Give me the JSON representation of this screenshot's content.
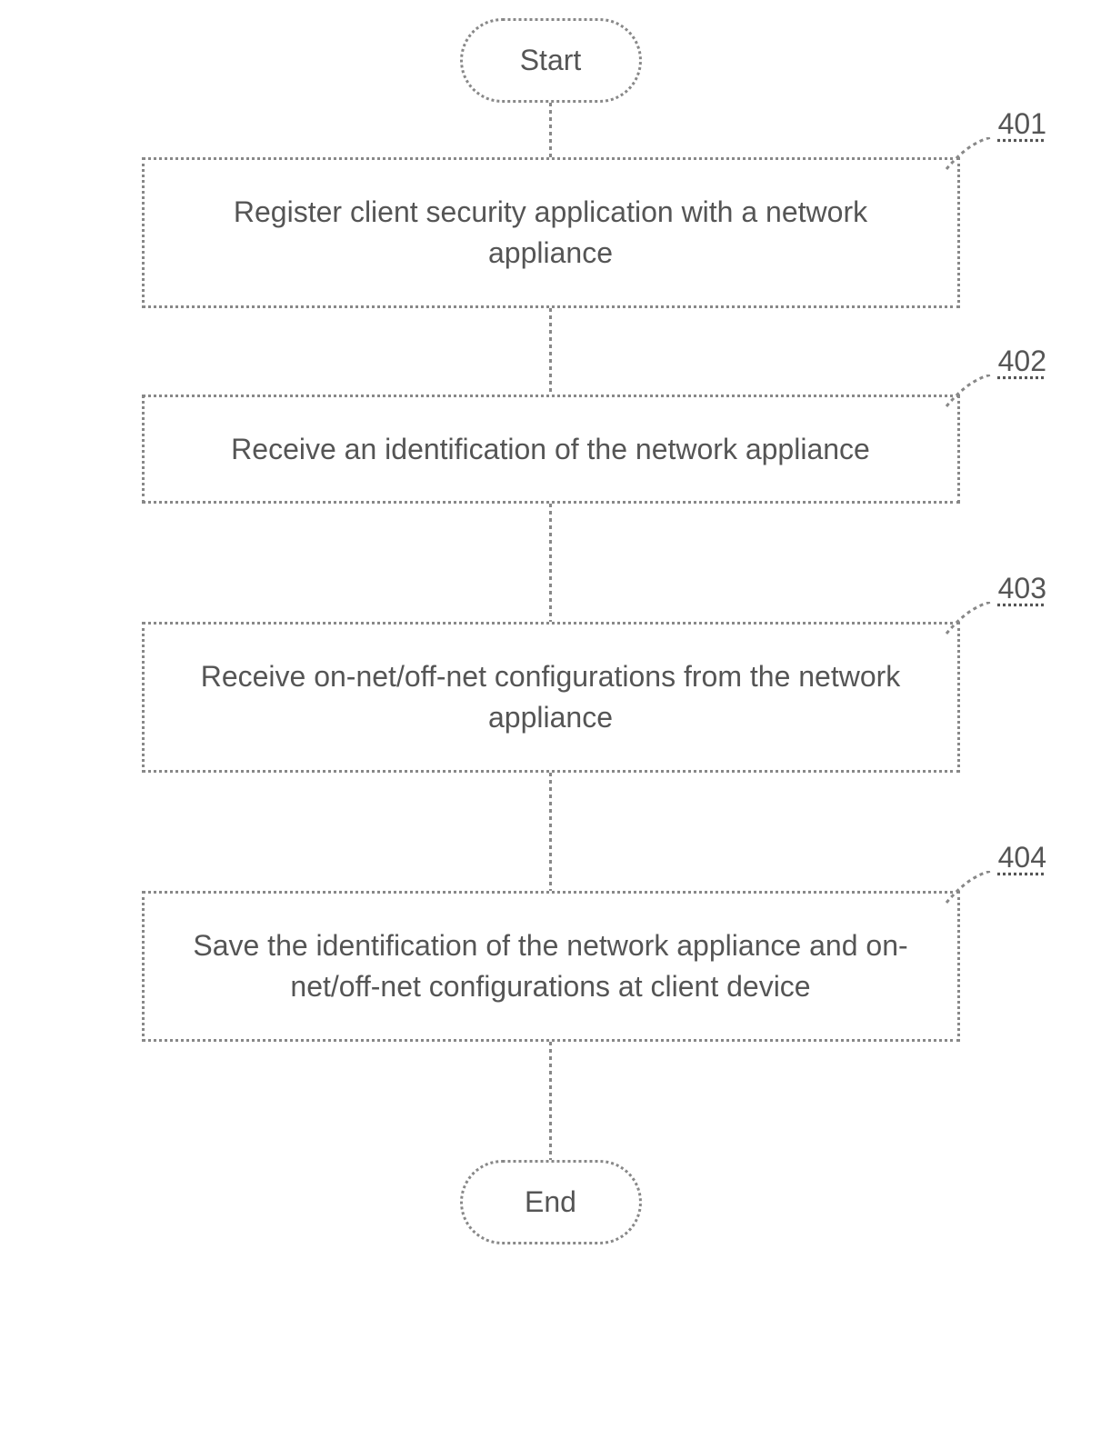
{
  "flowchart": {
    "start": "Start",
    "end": "End",
    "steps": [
      {
        "ref": "401",
        "text": "Register client security application with a network appliance"
      },
      {
        "ref": "402",
        "text": "Receive an identification of the network appliance"
      },
      {
        "ref": "403",
        "text": "Receive on-net/off-net configurations from the network appliance"
      },
      {
        "ref": "404",
        "text": "Save the identification of the network appliance and on-net/off-net configurations at client device"
      }
    ]
  }
}
